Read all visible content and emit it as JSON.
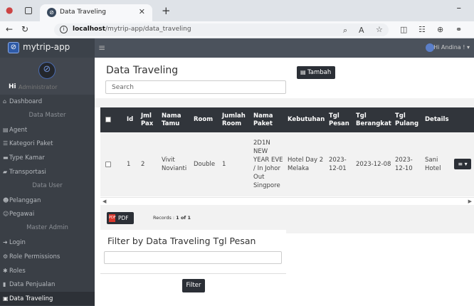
{
  "browser": {
    "tab_title": "Data Traveling",
    "url_host": "localhost",
    "url_path": "/mytrip-app/data_traveling"
  },
  "app": {
    "brand": "mytrip-app",
    "user_greeting": "Hi Andina !",
    "profile_hi": "Hi",
    "profile_role": "Administrator"
  },
  "sidebar": {
    "items": [
      {
        "type": "item",
        "label": "Dashboard",
        "icon": "dashboard-icon",
        "glyph": "⌂"
      },
      {
        "type": "header",
        "label": "Data Master"
      },
      {
        "type": "item",
        "label": "Agent",
        "icon": "bank-icon",
        "glyph": "▤"
      },
      {
        "type": "item",
        "label": "Kategori Paket",
        "icon": "list-icon",
        "glyph": "☰"
      },
      {
        "type": "item",
        "label": "Type Kamar",
        "icon": "bed-icon",
        "glyph": "▬"
      },
      {
        "type": "item",
        "label": "Transportasi",
        "icon": "car-icon",
        "glyph": "▰"
      },
      {
        "type": "header",
        "label": "Data User"
      },
      {
        "type": "item",
        "label": "Pelanggan",
        "icon": "users-icon",
        "glyph": "☻"
      },
      {
        "type": "item",
        "label": "Pegawai",
        "icon": "user-group-icon",
        "glyph": "☺"
      },
      {
        "type": "header",
        "label": "Master Admin"
      },
      {
        "type": "item",
        "label": "Login",
        "icon": "login-icon",
        "glyph": "➜"
      },
      {
        "type": "item",
        "label": "Role Permissions",
        "icon": "cogs-icon",
        "glyph": "⚙"
      },
      {
        "type": "item",
        "label": "Roles",
        "icon": "cog-icon",
        "glyph": "✱"
      },
      {
        "type": "item",
        "label": "Data Penjualan",
        "icon": "file-icon",
        "glyph": "▮"
      },
      {
        "type": "item",
        "label": "Data Traveling",
        "icon": "file-text-icon",
        "glyph": "▣",
        "active": true
      }
    ]
  },
  "page": {
    "title": "Data Traveling",
    "add_button": "Tambah",
    "search_placeholder": "Search"
  },
  "table": {
    "headers": {
      "id": "Id",
      "jml_pax": "Jml Pax",
      "nama_tamu": "Nama Tamu",
      "room": "Room",
      "jumlah_room": "Jumlah Room",
      "nama_paket": "Nama Paket",
      "kebutuhan": "Kebutuhan",
      "tgl_pesan": "Tgl Pesan",
      "tgl_berangkat": "Tgl Berangkat",
      "tgl_pulang": "Tgl Pulang",
      "details": "Details"
    },
    "rows": [
      {
        "id": "1",
        "jml_pax": "2",
        "nama_tamu": "Vivit Novianti",
        "room": "Double",
        "jumlah_room": "1",
        "nama_paket": "2D1N NEW YEAR EVE / In Johor Out Singpore",
        "kebutuhan": "Hotel Day 2 Melaka",
        "tgl_pesan": "2023-12-01",
        "tgl_berangkat": "2023-12-08",
        "tgl_pulang": "2023-12-10",
        "details": "Sani Hotel",
        "action": "≡ ▾"
      }
    ]
  },
  "footer": {
    "pdf_button": "PDF",
    "records_label": "Records : ",
    "records_value": "1 of 1"
  },
  "filter": {
    "title": "Filter by Data Traveling Tgl Pesan",
    "input_value": "",
    "button": "Filter"
  }
}
